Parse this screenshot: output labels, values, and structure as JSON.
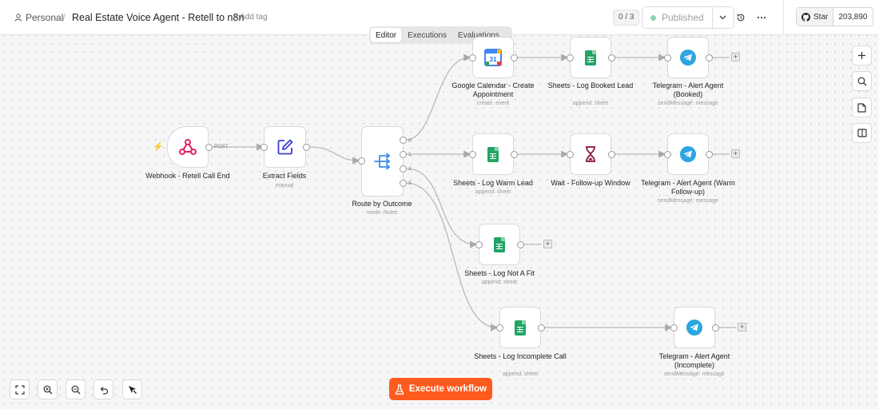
{
  "header": {
    "workspace": "Personal",
    "workflow_title": "Real Estate Voice Agent - Retell to n8n",
    "add_tag": "+ Add tag",
    "counter": "0 / 3",
    "publish_label": "Published",
    "github_star": "Star",
    "github_count": "203,890"
  },
  "tabs": [
    {
      "label": "Editor"
    },
    {
      "label": "Executions"
    },
    {
      "label": "Evaluations"
    }
  ],
  "nodes": {
    "webhook": {
      "label": "Webhook - Retell Call End",
      "edge_label": "POST"
    },
    "extract": {
      "label": "Extract Fields",
      "sub": "manual"
    },
    "router": {
      "label": "Route by Outcome",
      "sub": "mode: Rules",
      "outputs": [
        "0",
        "1",
        "2",
        "3"
      ]
    },
    "calendar": {
      "label": "Google Calendar - Create Appointment",
      "sub": "create: event"
    },
    "sheet_booked": {
      "label": "Sheets - Log Booked Lead",
      "sub": "append: sheet"
    },
    "tg_booked": {
      "label": "Telegram - Alert Agent (Booked)",
      "sub": "sendMessage: message"
    },
    "sheet_warm": {
      "label": "Sheets - Log Warm Lead",
      "sub": "append: sheet"
    },
    "wait": {
      "label": "Wait - Follow-up Window"
    },
    "tg_warm": {
      "label": "Telegram - Alert Agent (Warm Follow-up)",
      "sub": "sendMessage: message"
    },
    "sheet_notfit": {
      "label": "Sheets - Log Not A Fit",
      "sub": "append: sheet"
    },
    "sheet_incomplete": {
      "label": "Sheets - Log Incomplete Call",
      "sub": "append: sheet"
    },
    "tg_incomplete": {
      "label": "Telegram - Alert Agent (Incomplete)",
      "sub": "sendMessage: message"
    }
  },
  "calendar_icon_day": "31",
  "plus_symbol": "+",
  "execute_button": "Execute workflow",
  "colors": {
    "accent": "#ff5b1f",
    "sheets": "#21a464",
    "telegram": "#2ca5e0",
    "webhook": "#e0245e",
    "published_dot": "#8fd3b0"
  }
}
